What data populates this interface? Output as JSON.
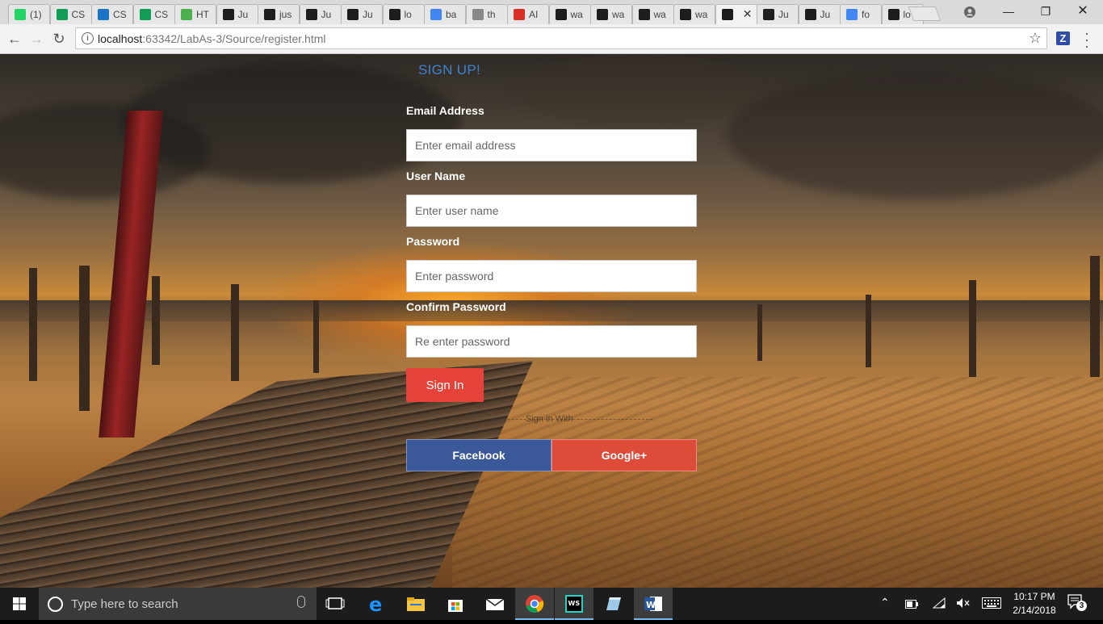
{
  "browser": {
    "tabs": [
      {
        "title": "(1)",
        "icon": "whatsapp-icon",
        "color": "#25d366"
      },
      {
        "title": "CS",
        "icon": "sheets-icon",
        "color": "#0f9d58"
      },
      {
        "title": "CS",
        "icon": "box-icon",
        "color": "#1b74c5"
      },
      {
        "title": "CS",
        "icon": "sheets-icon",
        "color": "#0f9d58"
      },
      {
        "title": "HT",
        "icon": "w3schools-icon",
        "color": "#4caf50"
      },
      {
        "title": "Ju",
        "icon": "webstorm-icon",
        "color": "#1d1d1d"
      },
      {
        "title": "jus",
        "icon": "webstorm-icon",
        "color": "#1d1d1d"
      },
      {
        "title": "Ju",
        "icon": "webstorm-icon",
        "color": "#1d1d1d"
      },
      {
        "title": "Ju",
        "icon": "webstorm-icon",
        "color": "#1d1d1d"
      },
      {
        "title": "lo",
        "icon": "webstorm-icon",
        "color": "#1d1d1d"
      },
      {
        "title": "ba",
        "icon": "google-icon",
        "color": "#4285f4"
      },
      {
        "title": "th",
        "icon": "document-icon",
        "color": "#888888"
      },
      {
        "title": "AI",
        "icon": "adblock-icon",
        "color": "#d93025"
      },
      {
        "title": "wa",
        "icon": "webstorm-icon",
        "color": "#1d1d1d"
      },
      {
        "title": "wa",
        "icon": "webstorm-icon",
        "color": "#1d1d1d"
      },
      {
        "title": "wa",
        "icon": "webstorm-icon",
        "color": "#1d1d1d"
      },
      {
        "title": "wa",
        "icon": "webstorm-icon",
        "color": "#1d1d1d"
      },
      {
        "title": "",
        "icon": "webstorm-icon",
        "color": "#1d1d1d",
        "active": true
      },
      {
        "title": "Ju",
        "icon": "webstorm-icon",
        "color": "#1d1d1d"
      },
      {
        "title": "Ju",
        "icon": "webstorm-icon",
        "color": "#1d1d1d"
      },
      {
        "title": "fo",
        "icon": "google-icon",
        "color": "#4285f4"
      },
      {
        "title": "lo",
        "icon": "webstorm-icon",
        "color": "#1d1d1d"
      }
    ],
    "active_tab_close": "✕",
    "url_host": "localhost",
    "url_rest": ":63342/LabAs-3/Source/register.html",
    "extension_label": "Z"
  },
  "form": {
    "title": "SIGN UP!",
    "email_label": "Email Address",
    "email_placeholder": "Enter email address",
    "username_label": "User Name",
    "username_placeholder": "Enter user name",
    "password_label": "Password",
    "password_placeholder": "Enter password",
    "confirm_label": "Confirm Password",
    "confirm_placeholder": "Re enter password",
    "signin_label": "Sign In",
    "divider_text": "Sign in With",
    "facebook_label": "Facebook",
    "google_label": "Google+"
  },
  "taskbar": {
    "search_placeholder": "Type here to search",
    "time": "10:17 PM",
    "date": "2/14/2018",
    "notification_count": "3"
  }
}
